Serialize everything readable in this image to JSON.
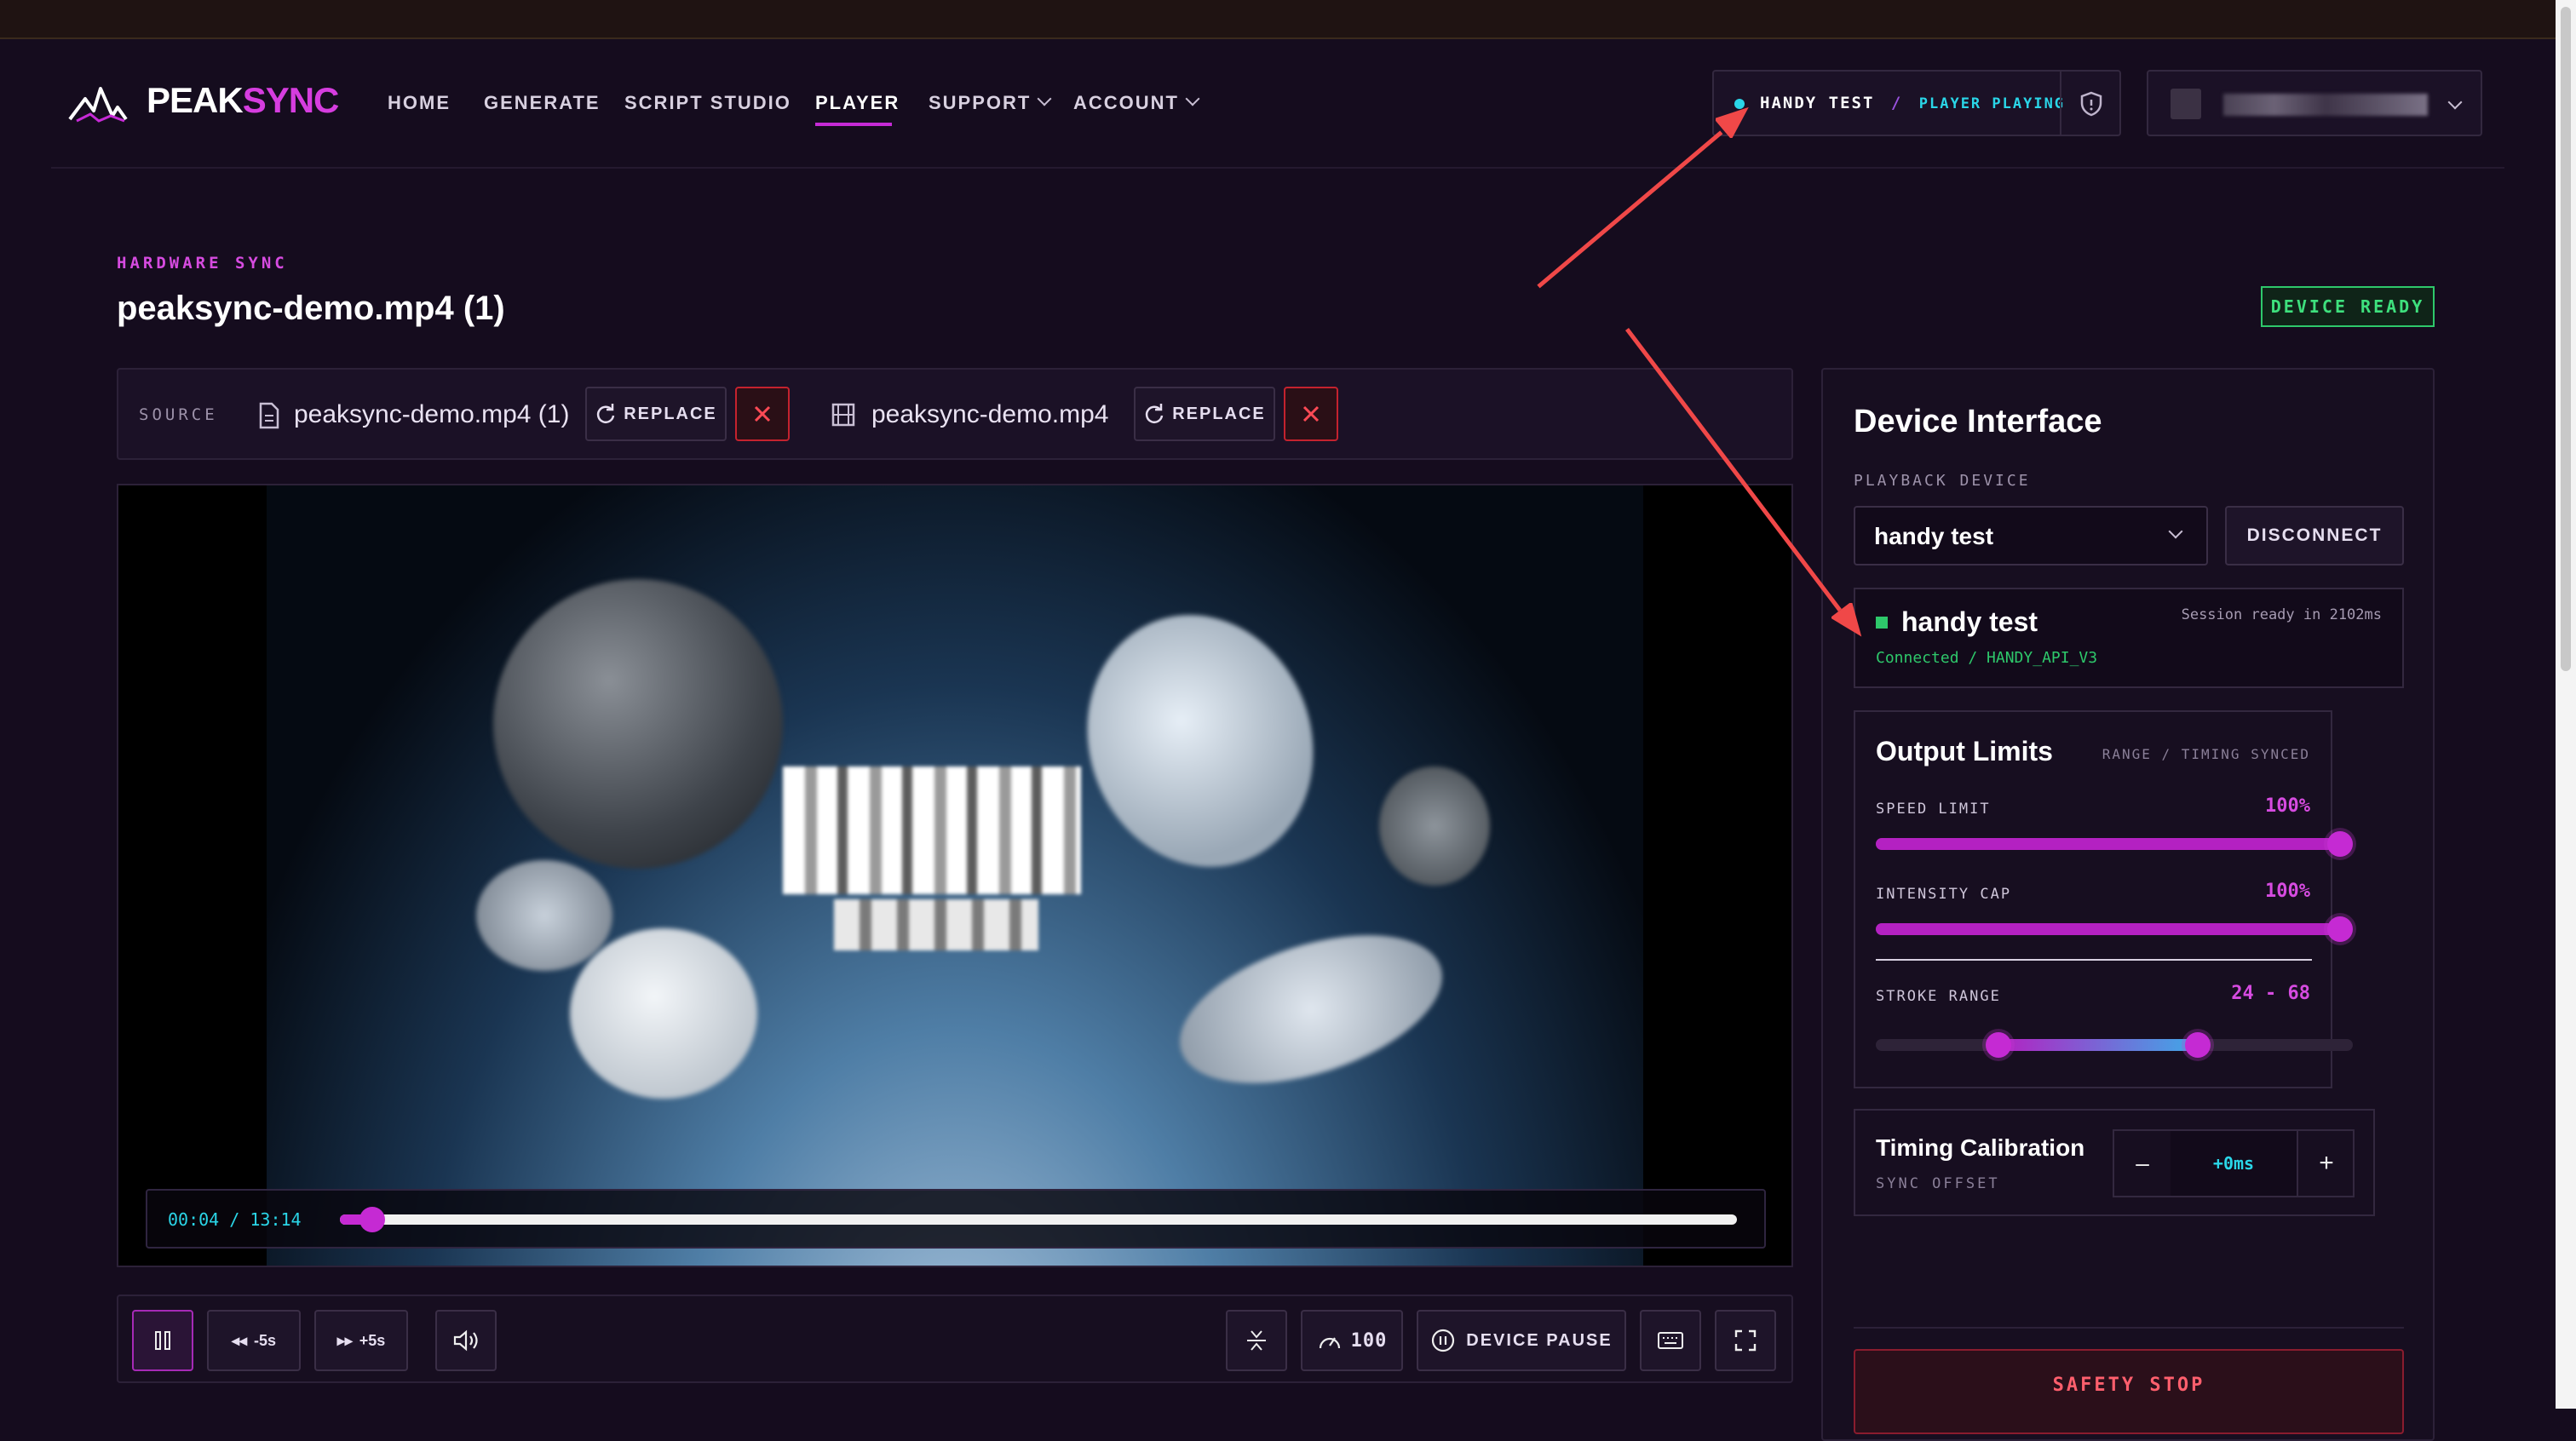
{
  "brand": {
    "part1": "PEAK",
    "part2": "SYNC"
  },
  "nav": {
    "home": "HOME",
    "generate": "GENERATE",
    "script_studio": "SCRIPT STUDIO",
    "player": "PLAYER",
    "support": "SUPPORT",
    "account": "ACCOUNT"
  },
  "status_pill": {
    "device": "HANDY TEST",
    "separator": "/",
    "state": "PLAYER PLAYING"
  },
  "page": {
    "eyebrow": "HARDWARE SYNC",
    "title": "peaksync-demo.mp4 (1)",
    "badge": "DEVICE READY"
  },
  "source": {
    "label": "SOURCE",
    "script_file": "peaksync-demo.mp4 (1)",
    "video_file": "peaksync-demo.mp4",
    "replace_label": "REPLACE"
  },
  "player": {
    "time_current": "00:04",
    "time_sep": "/",
    "time_total": "13:14",
    "progress_fraction": 0.014,
    "back_label": "-5s",
    "forward_label": "+5s",
    "speed_value": "100",
    "device_pause": "DEVICE PAUSE"
  },
  "device": {
    "title": "Device Interface",
    "playback_label": "PLAYBACK DEVICE",
    "selected": "handy test",
    "disconnect": "DISCONNECT",
    "card_name": "handy test",
    "session": "Session ready in 2102ms",
    "connection": "Connected / HANDY_API_V3"
  },
  "limits": {
    "title": "Output Limits",
    "meta": "RANGE / TIMING SYNCED",
    "speed_label": "SPEED LIMIT",
    "speed_value": "100%",
    "speed_fraction": 1.0,
    "intensity_label": "INTENSITY CAP",
    "intensity_value": "100%",
    "intensity_fraction": 1.0,
    "stroke_label": "STROKE RANGE",
    "stroke_value": "24 - 68",
    "stroke_min": 24,
    "stroke_max": 68
  },
  "timing": {
    "title": "Timing Calibration",
    "subtitle": "SYNC OFFSET",
    "minus": "–",
    "value": "+0ms",
    "plus": "+"
  },
  "safety": {
    "label": "SAFETY STOP"
  },
  "colors": {
    "accent": "#b421c2",
    "brand_pink": "#d63ddf",
    "ready_green": "#2ec86b",
    "status_cyan": "#2ad6e8",
    "annotation_red": "#f04848"
  },
  "icons": [
    "logo-mountain-icon",
    "shield-icon",
    "file-icon",
    "film-icon",
    "refresh-icon",
    "close-icon",
    "pause-icon",
    "rewind-icon",
    "fast-forward-icon",
    "volume-icon",
    "sync-icon",
    "gauge-icon",
    "pause-circle-icon",
    "keyboard-icon",
    "fullscreen-icon",
    "chevron-down-icon"
  ]
}
